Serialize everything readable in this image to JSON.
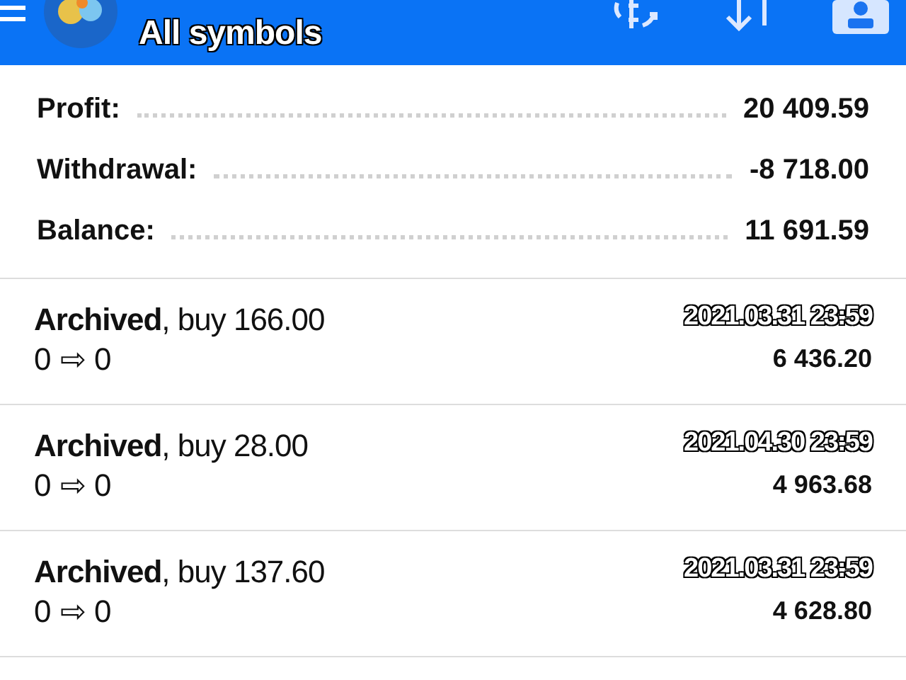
{
  "header": {
    "title": "All symbols"
  },
  "summary": [
    {
      "label": "Profit:",
      "value": "20 409.59"
    },
    {
      "label": "Withdrawal:",
      "value": "-8 718.00"
    },
    {
      "label": "Balance:",
      "value": "11 691.59"
    }
  ],
  "deals": [
    {
      "description": "**Archived**, buy 166.00",
      "prices": "0 ⇨ 0",
      "time": "2021.03.31 23:59",
      "amount": "6 436.20"
    },
    {
      "description": "**Archived**, buy 28.00",
      "prices": "0 ⇨ 0",
      "time": "2021.04.30 23:59",
      "amount": "4 963.68"
    },
    {
      "description": "**Archived**, buy 137.60",
      "prices": "0 ⇨ 0",
      "time": "2021.03.31 23:59",
      "amount": "4 628.80"
    }
  ]
}
